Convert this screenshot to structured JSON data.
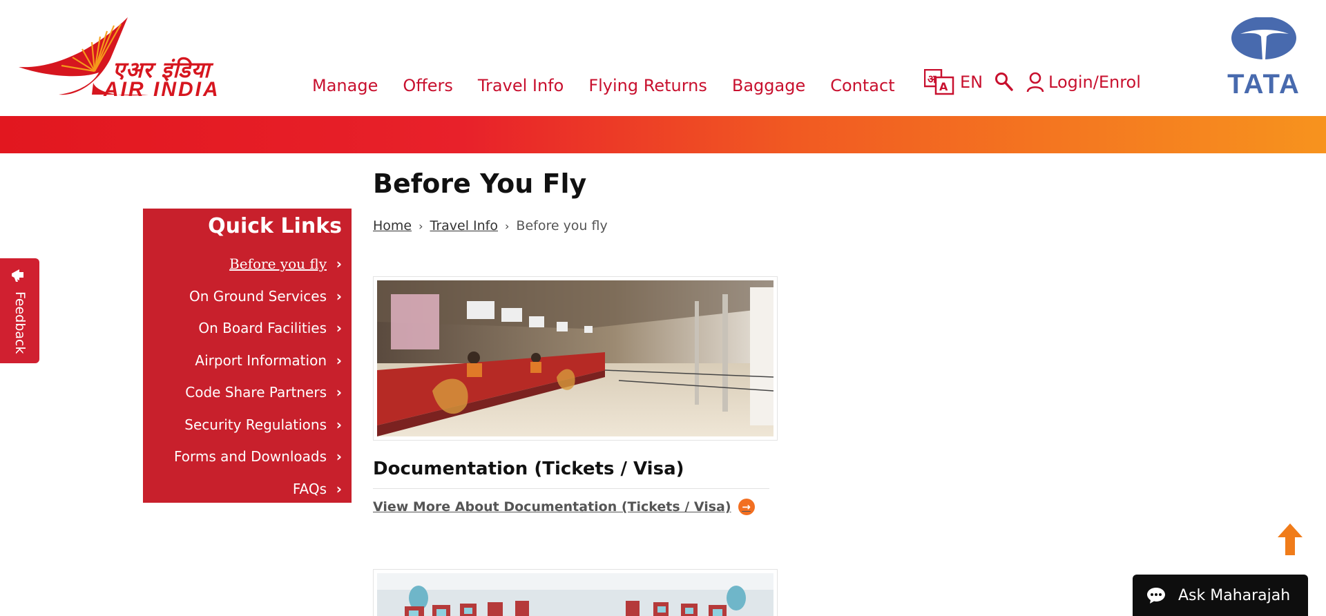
{
  "brand": {
    "hindi_name": "एअर इंडिया",
    "english_name": "AIR INDIA",
    "partner_logo": "TATA",
    "primary_color": "#c8102e",
    "banner_gradient": [
      "#e2171f",
      "#f15a22",
      "#f7931e"
    ]
  },
  "nav": {
    "items": [
      "Manage",
      "Offers",
      "Travel Info",
      "Flying Returns",
      "Baggage",
      "Contact"
    ]
  },
  "header_tools": {
    "language": "EN",
    "language_icon": "translate-icon",
    "search_icon": "search-icon",
    "login_label": "Login/Enrol"
  },
  "feedback": {
    "label": "Feedback"
  },
  "page": {
    "title": "Before You Fly",
    "breadcrumb": [
      "Home",
      "Travel Info",
      "Before you fly"
    ]
  },
  "quick_links": {
    "title": "Quick Links",
    "items": [
      "Before you fly",
      "On Ground Services",
      "On Board Facilities",
      "Airport Information",
      "Code Share Partners",
      "Security Regulations",
      "Forms and Downloads",
      "FAQs"
    ],
    "active_index": 0
  },
  "cards": [
    {
      "title": "Documentation (Tickets / Visa)",
      "link": "View More About Documentation (Tickets / Visa)",
      "image": "airport check-in counters"
    },
    {
      "image": "aircraft cabin seats"
    }
  ],
  "chat": {
    "label": "Ask Maharajah"
  }
}
